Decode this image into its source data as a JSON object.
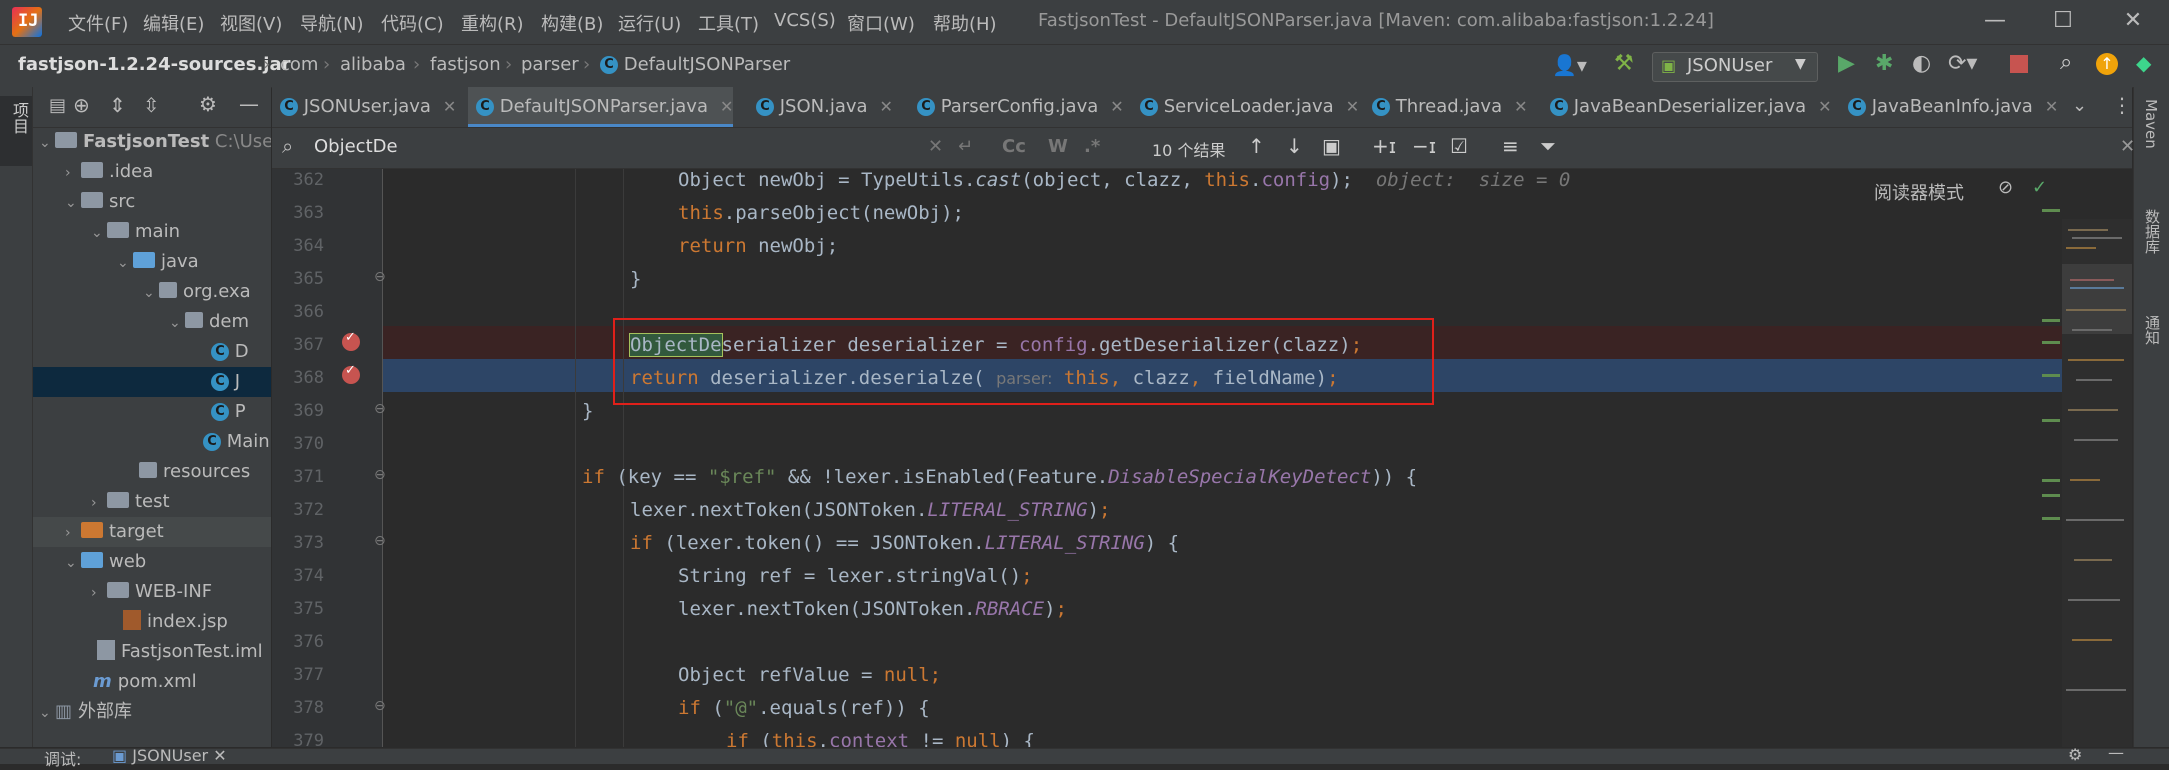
{
  "menu": [
    "文件(F)",
    "编辑(E)",
    "视图(V)",
    "导航(N)",
    "代码(C)",
    "重构(R)",
    "构建(B)",
    "运行(U)",
    "工具(T)",
    "VCS(S)",
    "窗口(W)",
    "帮助(H)"
  ],
  "window_title": "FastjsonTest - DefaultJSONParser.java [Maven: com.alibaba:fastjson:1.2.24]",
  "breadcrumbs": [
    "fastjson-1.2.24-sources.jar",
    "com",
    "alibaba",
    "fastjson",
    "parser",
    "DefaultJSONParser"
  ],
  "run_config": "JSONUser",
  "project_tool_label": "项目",
  "tree": [
    {
      "label": "FastjsonTest",
      "suffix": "C:\\User"
    },
    {
      "label": ".idea"
    },
    {
      "label": "src"
    },
    {
      "label": "main"
    },
    {
      "label": "java"
    },
    {
      "label": "org.exa"
    },
    {
      "label": "dem"
    },
    {
      "label": "D"
    },
    {
      "label": "J"
    },
    {
      "label": "P"
    },
    {
      "label": "Main"
    },
    {
      "label": "resources"
    },
    {
      "label": "test"
    },
    {
      "label": "target"
    },
    {
      "label": "web"
    },
    {
      "label": "WEB-INF"
    },
    {
      "label": "index.jsp"
    },
    {
      "label": "FastjsonTest.iml"
    },
    {
      "label": "pom.xml"
    },
    {
      "label": "外部库"
    }
  ],
  "tabs": [
    "JSONUser.java",
    "DefaultJSONParser.java",
    "JSON.java",
    "ParserConfig.java",
    "ServiceLoader.java",
    "Thread.java",
    "JavaBeanDeserializer.java",
    "JavaBeanInfo.java"
  ],
  "find": {
    "query": "ObjectDe",
    "results": "10 个结果",
    "cc": "Cc",
    "w": "W",
    "regex": ".*"
  },
  "reader_mode": "阅读器模式",
  "right_tools": [
    "Maven",
    "数据库",
    "通知"
  ],
  "line_numbers": [
    "362",
    "363",
    "364",
    "365",
    "366",
    "367",
    "368",
    "369",
    "370",
    "371",
    "372",
    "373",
    "374",
    "375",
    "376",
    "377",
    "378",
    "379"
  ],
  "inlay": {
    "line362": "object:  size = 0",
    "param": "parser:"
  },
  "bottom": {
    "debug_label": "调试:",
    "session": "JSONUser"
  }
}
